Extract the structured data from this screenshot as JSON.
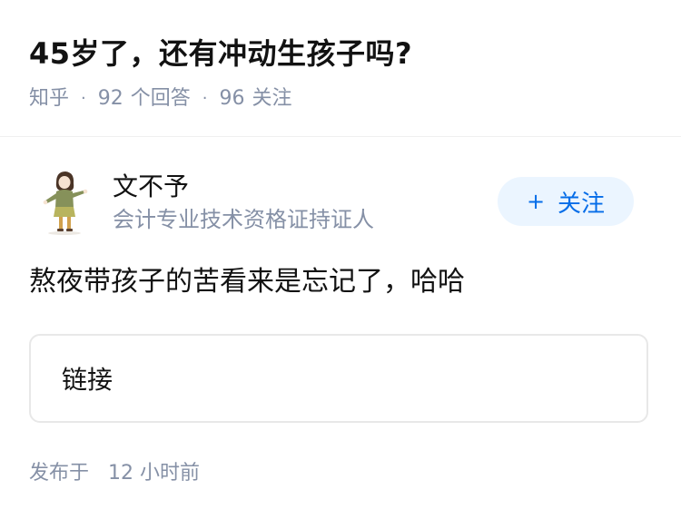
{
  "question": {
    "title": "45岁了，还有冲动生孩子吗?",
    "source": "知乎",
    "answers_count": "92",
    "answers_label": "个回答",
    "followers_count": "96",
    "followers_label": "关注",
    "separator": "·"
  },
  "author": {
    "name": "文不予",
    "bio": "会计专业技术资格证持证人",
    "follow_plus": "+",
    "follow_label": "关注"
  },
  "answer": {
    "text": "熬夜带孩子的苦看来是忘记了，哈哈",
    "link_label": "链接",
    "published_prefix": "发布于",
    "published_value": "12",
    "published_suffix": "小时前"
  },
  "colors": {
    "accent": "#056de8",
    "follow_bg": "#ebf5ff",
    "meta_text": "#8590a6"
  }
}
